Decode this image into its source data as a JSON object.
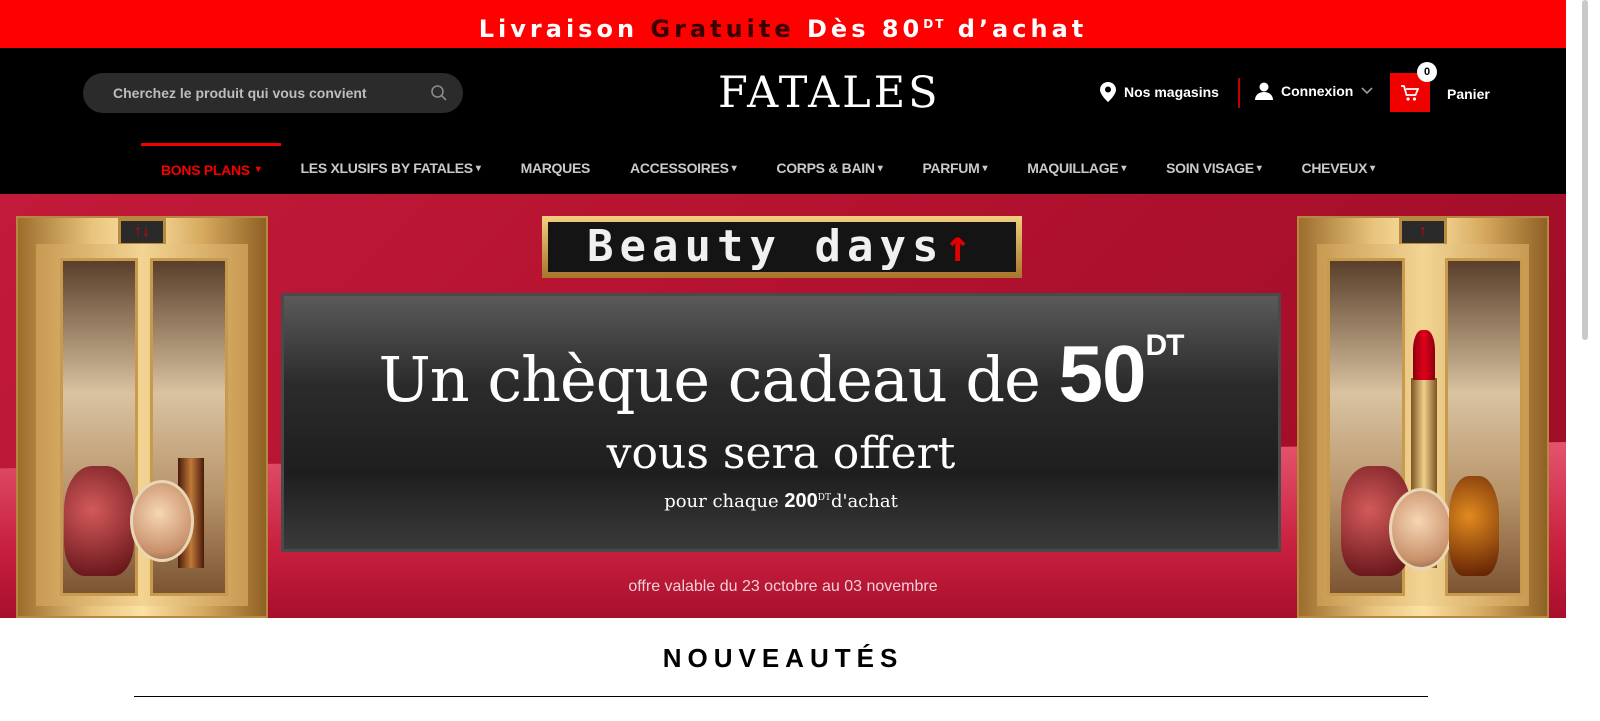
{
  "promo": {
    "part1": "Livraison ",
    "part2": "Gratuite",
    "part3": " Dès 80",
    "sup": "DT",
    "part4": " d’achat"
  },
  "header": {
    "search_placeholder": "Cherchez le produit qui vous convient",
    "logo": "FATALES",
    "stores_label": "Nos magasins",
    "login_label": "Connexion",
    "cart_count": "0",
    "cart_label": "Panier"
  },
  "nav": [
    {
      "label": "BONS PLANS",
      "caret": "▾",
      "active": true
    },
    {
      "label": "LES XLUSIFS BY FATALES",
      "caret": "▾"
    },
    {
      "label": "MARQUES",
      "caret": ""
    },
    {
      "label": "ACCESSOIRES",
      "caret": "▾"
    },
    {
      "label": "CORPS & BAIN",
      "caret": "▾"
    },
    {
      "label": "PARFUM",
      "caret": "▾"
    },
    {
      "label": "MAQUILLAGE",
      "caret": "▾"
    },
    {
      "label": "SOIN VISAGE",
      "caret": "▾"
    },
    {
      "label": "CHEVEUX",
      "caret": "▾"
    }
  ],
  "banner": {
    "sign_text": "Beauty days",
    "sign_arrow": "↑",
    "left_display": "↑↓",
    "right_display": "↑",
    "headline_prefix": "Un chèque cadeau de ",
    "headline_amount": "50",
    "headline_unit": "DT",
    "subline": "vous sera offert",
    "condition_prefix": "pour chaque ",
    "condition_amount": "200",
    "condition_unit": "DT",
    "condition_suffix": "d'achat",
    "validity": "offre valable du 23 octobre au 03 novembre"
  },
  "section_title": "NOUVEAUTÉS",
  "colors": {
    "accent": "#fe0000",
    "header_bg": "#000000",
    "banner_bg": "#b3122f"
  }
}
